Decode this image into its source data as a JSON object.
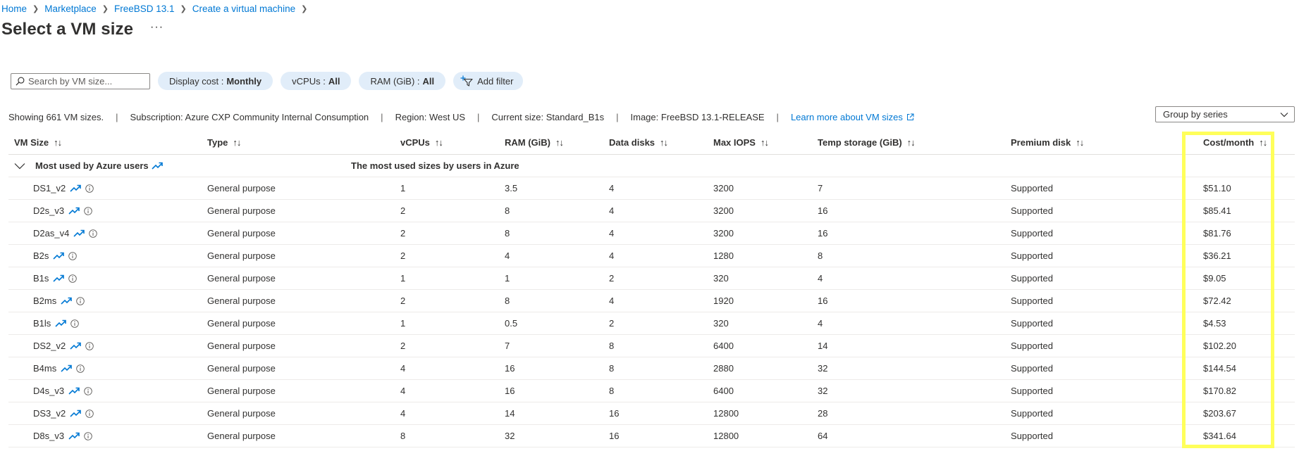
{
  "breadcrumb": [
    "Home",
    "Marketplace",
    "FreeBSD 13.1",
    "Create a virtual machine"
  ],
  "page": {
    "title": "Select a VM size",
    "more": "···"
  },
  "filters": {
    "search_placeholder": "Search by VM size...",
    "display_cost_label": "Display cost :",
    "display_cost_value": "Monthly",
    "vcpus_label": "vCPUs :",
    "vcpus_value": "All",
    "ram_label": "RAM (GiB) :",
    "ram_value": "All",
    "add_filter": "Add filter"
  },
  "info": {
    "count": "Showing 661 VM sizes.",
    "subscription": "Subscription: Azure CXP Community Internal Consumption",
    "region": "Region: West US",
    "current_size": "Current size: Standard_B1s",
    "image": "Image: FreeBSD 13.1-RELEASE",
    "learn_more": "Learn more about VM sizes",
    "group_by": "Group by series"
  },
  "table": {
    "columns": [
      "VM Size",
      "Type",
      "vCPUs",
      "RAM (GiB)",
      "Data disks",
      "Max IOPS",
      "Temp storage (GiB)",
      "Premium disk",
      "Cost/month"
    ],
    "sort_glyph": "↑↓",
    "group": {
      "name": "Most used by Azure users",
      "description": "The most used sizes by users in Azure"
    },
    "rows": [
      {
        "size": "DS1_v2",
        "type": "General purpose",
        "vcpus": "1",
        "ram": "3.5",
        "disks": "4",
        "iops": "3200",
        "temp": "7",
        "premium": "Supported",
        "cost": "$51.10"
      },
      {
        "size": "D2s_v3",
        "type": "General purpose",
        "vcpus": "2",
        "ram": "8",
        "disks": "4",
        "iops": "3200",
        "temp": "16",
        "premium": "Supported",
        "cost": "$85.41"
      },
      {
        "size": "D2as_v4",
        "type": "General purpose",
        "vcpus": "2",
        "ram": "8",
        "disks": "4",
        "iops": "3200",
        "temp": "16",
        "premium": "Supported",
        "cost": "$81.76"
      },
      {
        "size": "B2s",
        "type": "General purpose",
        "vcpus": "2",
        "ram": "4",
        "disks": "4",
        "iops": "1280",
        "temp": "8",
        "premium": "Supported",
        "cost": "$36.21"
      },
      {
        "size": "B1s",
        "type": "General purpose",
        "vcpus": "1",
        "ram": "1",
        "disks": "2",
        "iops": "320",
        "temp": "4",
        "premium": "Supported",
        "cost": "$9.05"
      },
      {
        "size": "B2ms",
        "type": "General purpose",
        "vcpus": "2",
        "ram": "8",
        "disks": "4",
        "iops": "1920",
        "temp": "16",
        "premium": "Supported",
        "cost": "$72.42"
      },
      {
        "size": "B1ls",
        "type": "General purpose",
        "vcpus": "1",
        "ram": "0.5",
        "disks": "2",
        "iops": "320",
        "temp": "4",
        "premium": "Supported",
        "cost": "$4.53"
      },
      {
        "size": "DS2_v2",
        "type": "General purpose",
        "vcpus": "2",
        "ram": "7",
        "disks": "8",
        "iops": "6400",
        "temp": "14",
        "premium": "Supported",
        "cost": "$102.20"
      },
      {
        "size": "B4ms",
        "type": "General purpose",
        "vcpus": "4",
        "ram": "16",
        "disks": "8",
        "iops": "2880",
        "temp": "32",
        "premium": "Supported",
        "cost": "$144.54"
      },
      {
        "size": "D4s_v3",
        "type": "General purpose",
        "vcpus": "4",
        "ram": "16",
        "disks": "8",
        "iops": "6400",
        "temp": "32",
        "premium": "Supported",
        "cost": "$170.82"
      },
      {
        "size": "DS3_v2",
        "type": "General purpose",
        "vcpus": "4",
        "ram": "14",
        "disks": "16",
        "iops": "12800",
        "temp": "28",
        "premium": "Supported",
        "cost": "$203.67"
      },
      {
        "size": "D8s_v3",
        "type": "General purpose",
        "vcpus": "8",
        "ram": "32",
        "disks": "16",
        "iops": "12800",
        "temp": "64",
        "premium": "Supported",
        "cost": "$341.64"
      }
    ]
  },
  "colors": {
    "link": "#0078d4",
    "pill_bg": "#e1edf9",
    "highlight": "#ffff5a"
  },
  "icons": [
    "chevron-right-icon",
    "search-icon",
    "add-filter-icon",
    "external-link-icon",
    "chevron-down-icon",
    "trending-icon",
    "info-icon",
    "sort-icon"
  ]
}
